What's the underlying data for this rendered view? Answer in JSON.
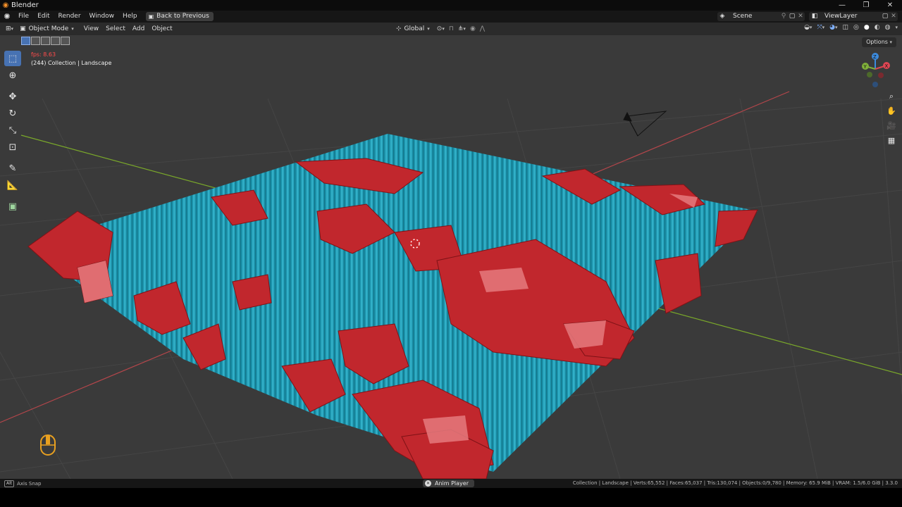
{
  "window": {
    "title": "Blender",
    "controls": [
      "—",
      "❐",
      "✕"
    ]
  },
  "menu": {
    "items": [
      "File",
      "Edit",
      "Render",
      "Window",
      "Help"
    ],
    "back_button": "Back to Previous",
    "scene": "Scene",
    "view_layer": "ViewLayer"
  },
  "header": {
    "mode": "Object Mode",
    "menus": [
      "View",
      "Select",
      "Add",
      "Object"
    ],
    "transform_orientation": "Global"
  },
  "viewport": {
    "fps": "fps: 8.63",
    "collection_info": "(244) Collection | Landscape",
    "options": "Options",
    "gizmo_axes": [
      "Z",
      "Y",
      "X"
    ]
  },
  "status": {
    "left_key": "Alt",
    "left_text": "Axis Snap",
    "center": "Anim Player",
    "right": "Collection | Landscape | Verts:65,552 | Faces:65,037 | Tris:130,074 | Objects:0/9,780 | Memory: 65.9 MiB | VRAM: 1.5/6.0 GiB | 3.3.0"
  },
  "colors": {
    "accent": "#4772b3",
    "grid": "#454545",
    "shard_red": "#c1272d",
    "crystal_blue": "#1f9bb4",
    "x_axis": "#b4464b",
    "y_axis": "#7aa82a"
  }
}
